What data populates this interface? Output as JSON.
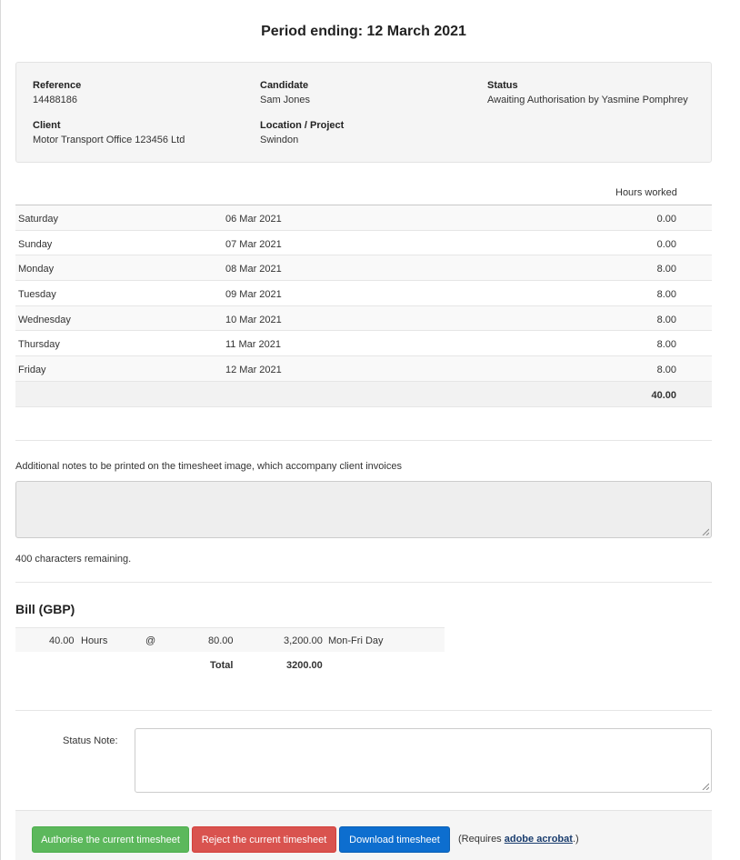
{
  "title": "Period ending: 12 March 2021",
  "info": {
    "reference_label": "Reference",
    "reference": "14488186",
    "candidate_label": "Candidate",
    "candidate": "Sam Jones",
    "status_label": "Status",
    "status": "Awaiting Authorisation by Yasmine Pomphrey",
    "client_label": "Client",
    "client": "Motor Transport Office 123456 Ltd",
    "location_label": "Location / Project",
    "location": "Swindon"
  },
  "hours": {
    "header": "Hours worked",
    "rows": [
      {
        "day": "Saturday",
        "date": "06 Mar 2021",
        "hours": "0.00"
      },
      {
        "day": "Sunday",
        "date": "07 Mar 2021",
        "hours": "0.00"
      },
      {
        "day": "Monday",
        "date": "08 Mar 2021",
        "hours": "8.00"
      },
      {
        "day": "Tuesday",
        "date": "09 Mar 2021",
        "hours": "8.00"
      },
      {
        "day": "Wednesday",
        "date": "10 Mar 2021",
        "hours": "8.00"
      },
      {
        "day": "Thursday",
        "date": "11 Mar 2021",
        "hours": "8.00"
      },
      {
        "day": "Friday",
        "date": "12 Mar 2021",
        "hours": "8.00"
      }
    ],
    "total": "40.00"
  },
  "notes": {
    "label": "Additional notes to be printed on the timesheet image, which accompany client invoices",
    "value": "",
    "remaining": "400 characters remaining."
  },
  "bill": {
    "title": "Bill (GBP)",
    "qty": "40.00",
    "unit": "Hours",
    "at": "@",
    "rate": "80.00",
    "amount": "3,200.00",
    "rate_name": "Mon-Fri Day",
    "total_label": "Total",
    "total": "3200.00"
  },
  "status_note": {
    "label": "Status Note:",
    "value": ""
  },
  "actions": {
    "authorise": "Authorise the current timesheet",
    "reject": "Reject the current timesheet",
    "download": "Download timesheet",
    "requires_prefix": "(Requires ",
    "requires_link": "adobe acrobat",
    "requires_suffix": ".)"
  },
  "colors": {
    "authorise": "#5cb85c",
    "reject": "#d9534f",
    "download": "#0d6ecf"
  },
  "icons": {
    "resize_grip": "textarea-resize-icon"
  }
}
